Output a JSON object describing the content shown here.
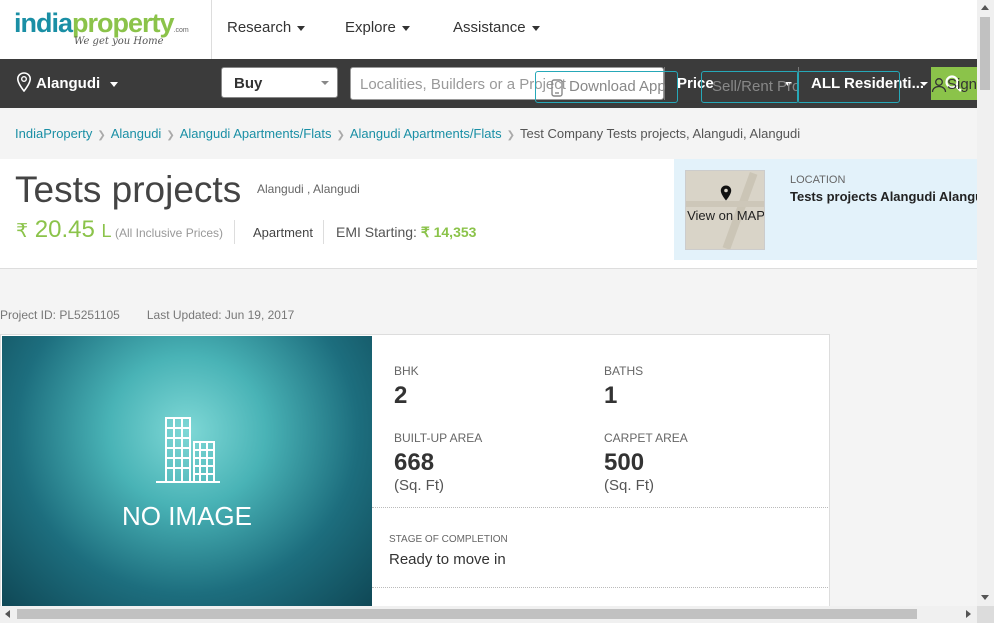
{
  "header": {
    "logo": {
      "part1": "india",
      "part2": "property",
      "dotcom": ".com",
      "tagline": "We get you Home"
    },
    "menu": [
      {
        "label": "Research"
      },
      {
        "label": "Explore"
      },
      {
        "label": "Assistance"
      }
    ]
  },
  "search": {
    "location": "Alangudi",
    "mode": "Buy",
    "placeholder": "Localities, Builders or a Project",
    "download_app": "Download App",
    "price": "Price",
    "sell_rent": "Sell/Rent Property",
    "residential": "ALL Residenti...",
    "signin": "Sign"
  },
  "breadcrumb": {
    "items": [
      "IndiaProperty",
      "Alangudi",
      "Alangudi Apartments/Flats",
      "Alangudi Apartments/Flats"
    ],
    "current": "Test Company Tests projects, Alangudi, Alangudi"
  },
  "project": {
    "title": "Tests projects",
    "location": "Alangudi , Alangudi",
    "currency": "₹",
    "price": "20.45",
    "price_unit": "L",
    "price_note": "(All Inclusive Prices)",
    "type": "Apartment",
    "emi_label": "EMI Starting:",
    "emi_value": "₹ 14,353"
  },
  "location_panel": {
    "map_label": "View on MAP",
    "label": "LOCATION",
    "value": "Tests projects Alangudi Alangudi"
  },
  "meta": {
    "project_id": "Project ID: PL5251105",
    "last_updated": "Last Updated: Jun 19, 2017"
  },
  "details": {
    "no_image": "NO IMAGE",
    "bhk_label": "BHK",
    "bhk_value": "2",
    "baths_label": "BATHS",
    "baths_value": "1",
    "builtup_label": "BUILT-UP AREA",
    "builtup_value": "668",
    "builtup_unit": "(Sq. Ft)",
    "carpet_label": "CARPET AREA",
    "carpet_value": "500",
    "carpet_unit": "(Sq. Ft)",
    "stage_label": "STAGE OF COMPLETION",
    "stage_value": "Ready to move in"
  },
  "colors": {
    "brand_teal": "#1a8fa5",
    "brand_green": "#8bc34a",
    "searchbar": "#3b3b3b",
    "location_panel": "#e3f2fa"
  }
}
